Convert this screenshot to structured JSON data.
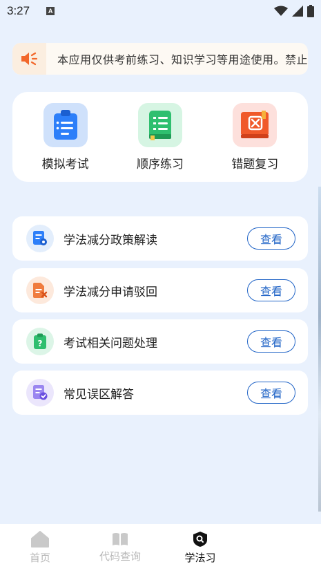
{
  "status_bar": {
    "time": "3:27",
    "notification_letter": "A"
  },
  "notice": {
    "icon": "speaker-icon",
    "text": "本应用仅供考前练习、知识学习等用途使用。禁止"
  },
  "features": [
    {
      "label": "模拟考试",
      "icon": "clipboard-icon",
      "color": "#2d7ff9"
    },
    {
      "label": "顺序练习",
      "icon": "notebook-icon",
      "color": "#2fbf6f"
    },
    {
      "label": "错题复习",
      "icon": "wrong-book-icon",
      "color": "#f0592a"
    }
  ],
  "list": [
    {
      "title": "学法减分政策解读",
      "button": "查看",
      "icon": "policy-doc-icon",
      "color": "#2d7ff9"
    },
    {
      "title": "学法减分申请驳回",
      "button": "查看",
      "icon": "rejected-doc-icon",
      "color": "#f07c3e"
    },
    {
      "title": "考试相关问题处理",
      "button": "查看",
      "icon": "question-clipboard-icon",
      "color": "#2fbf6f"
    },
    {
      "title": "常见误区解答",
      "button": "查看",
      "icon": "check-doc-icon",
      "color": "#7a63e8"
    }
  ],
  "tabbar": {
    "tabs": [
      {
        "label": "首页",
        "icon": "home-icon",
        "active": false
      },
      {
        "label": "代码查询",
        "icon": "book-icon",
        "active": false
      },
      {
        "label": "学法习",
        "icon": "search-badge-icon",
        "active": true
      }
    ]
  }
}
